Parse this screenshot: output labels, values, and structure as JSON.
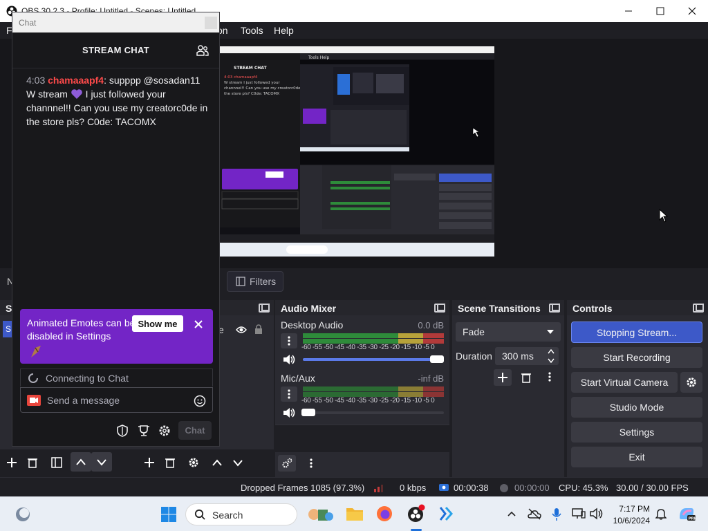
{
  "window": {
    "title": "OBS 30.2.3 - Profile: Untitled - Scenes: Untitled",
    "minimize_icon": "minimize-icon",
    "maximize_icon": "maximize-icon",
    "close_icon": "close-icon"
  },
  "menubar": {
    "items": [
      "F",
      "on",
      "Tools",
      "Help"
    ]
  },
  "sources_toolbar": {
    "filters_label": "Filters",
    "left_clip_letter": "N"
  },
  "scenes_dock": {
    "title_clip": "S",
    "row_clip": "S"
  },
  "sources_dock": {
    "row_clip": "e"
  },
  "audio_mixer": {
    "title": "Audio Mixer",
    "channels": [
      {
        "name": "Desktop Audio",
        "level": "0.0 dB",
        "volume": 1.0
      },
      {
        "name": "Mic/Aux",
        "level": "-inf dB",
        "volume": 0.0
      }
    ],
    "ticks": "-60 -55 -50 -45 -40 -35 -30 -25 -20 -15 -10 -5 0"
  },
  "scene_transitions": {
    "title": "Scene Transitions",
    "transition": "Fade",
    "duration_label": "Duration",
    "duration_value": "300 ms"
  },
  "controls": {
    "title": "Controls",
    "buttons": [
      "Stopping Stream...",
      "Start Recording",
      "Start Virtual Camera",
      "Studio Mode",
      "Settings",
      "Exit"
    ]
  },
  "statusbar": {
    "dropped_frames": "Dropped Frames 1085 (97.3%)",
    "kbps": "0 kbps",
    "stream_time": "00:00:38",
    "rec_time": "00:00:00",
    "cpu": "CPU: 45.3%",
    "fps": "30.00 / 30.00 FPS"
  },
  "chat": {
    "window_title": "Chat",
    "header": "STREAM CHAT",
    "message": {
      "timestamp": "4:03",
      "user": "chamaaapf4",
      "text_1": ": supppp @sosadan11 W stream ",
      "text_2": " I just followed your channnel!! Can you use my creatorc0de in the store pls? C0de: TACOMX"
    },
    "promo_text": "Animated Emotes can be disabled in Settings",
    "show_me": "Show me",
    "connecting": "Connecting to Chat",
    "send_placeholder": "Send a message",
    "chat_button": "Chat"
  },
  "taskbar": {
    "search_label": "Search",
    "time": "7:17 PM",
    "date": "10/6/2024"
  },
  "colors": {
    "accent_blue": "#3d59c8",
    "twitch_purple": "#7325c6",
    "username_red": "#ff4a4a",
    "meter_green": "#2e8b3a",
    "meter_yellow": "#b7a23a",
    "meter_red": "#b23a3a"
  }
}
